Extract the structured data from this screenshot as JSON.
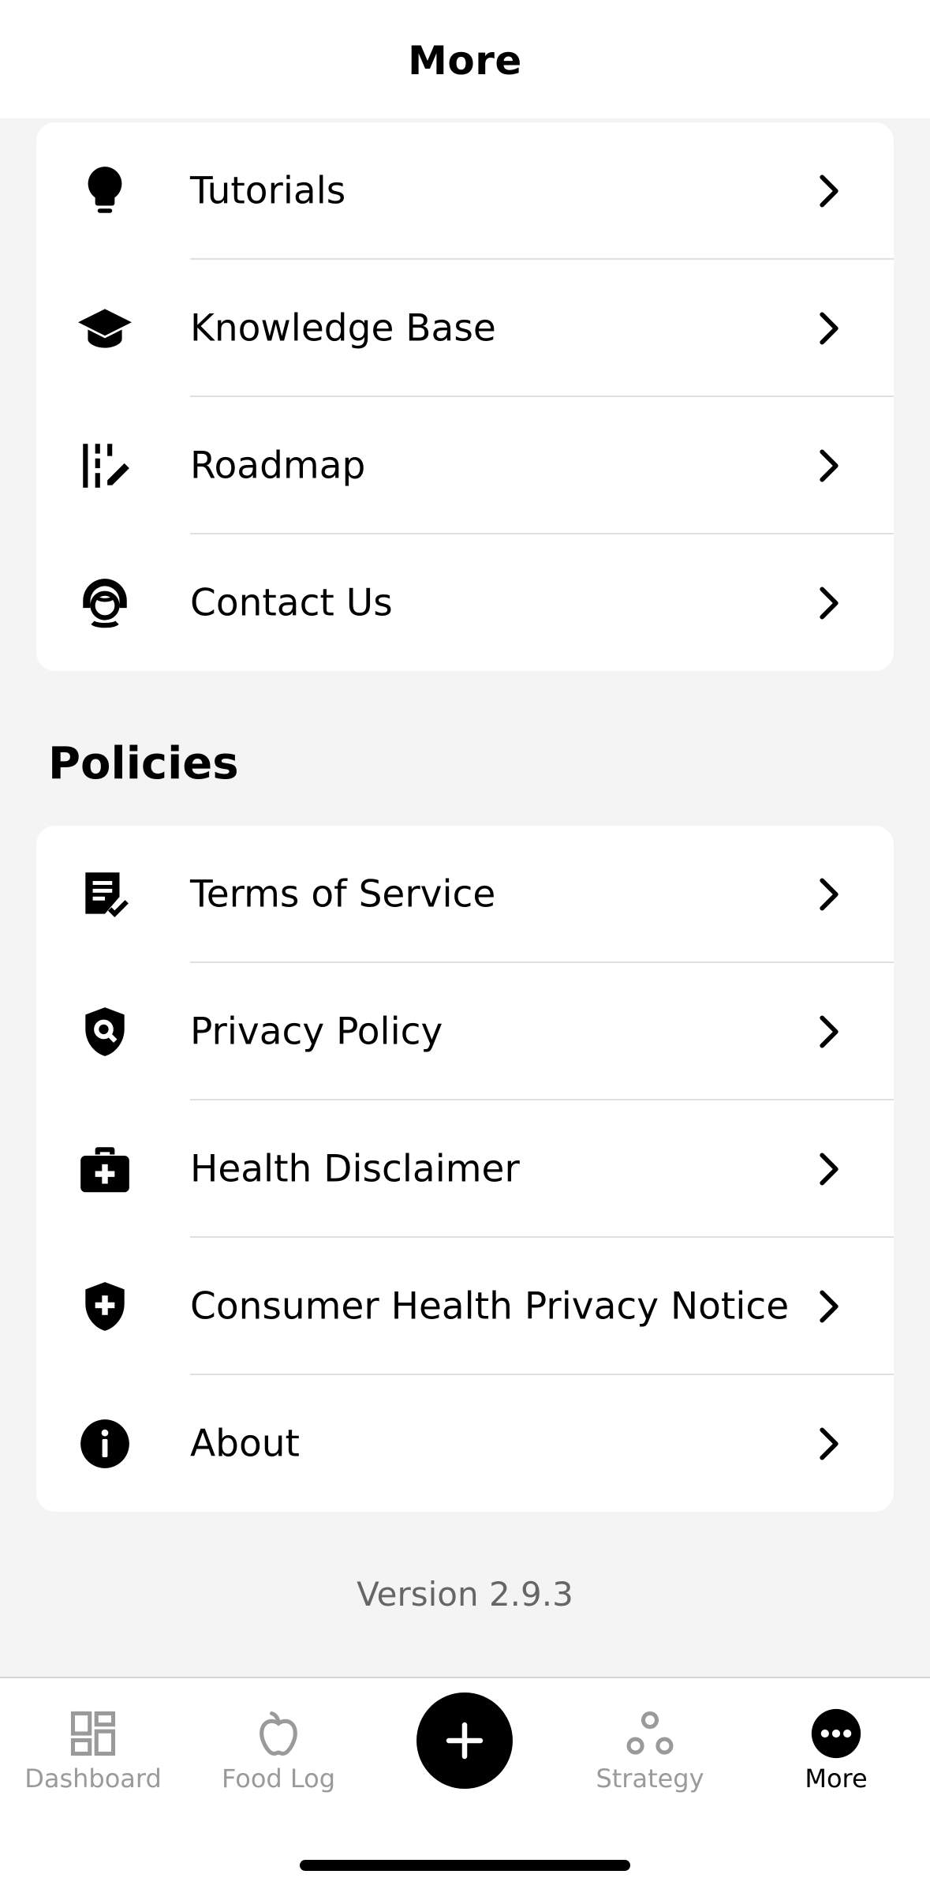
{
  "header": {
    "title": "More"
  },
  "support_items": [
    {
      "label": "Tutorials",
      "icon": "lightbulb-icon"
    },
    {
      "label": "Knowledge Base",
      "icon": "graduation-cap-icon"
    },
    {
      "label": "Roadmap",
      "icon": "roadmap-icon"
    },
    {
      "label": "Contact Us",
      "icon": "support-agent-icon"
    }
  ],
  "policies": {
    "title": "Policies",
    "items": [
      {
        "label": "Terms of Service",
        "icon": "document-check-icon"
      },
      {
        "label": "Privacy Policy",
        "icon": "shield-search-icon"
      },
      {
        "label": "Health Disclaimer",
        "icon": "medical-bag-icon"
      },
      {
        "label": "Consumer Health Privacy Notice",
        "icon": "shield-plus-icon"
      },
      {
        "label": "About",
        "icon": "info-icon"
      }
    ]
  },
  "version": "Version 2.9.3",
  "tabbar": {
    "tabs": [
      {
        "label": "Dashboard",
        "icon": "dashboard-icon",
        "active": false
      },
      {
        "label": "Food Log",
        "icon": "apple-icon",
        "active": false
      },
      {
        "label": "Strategy",
        "icon": "strategy-icon",
        "active": false
      },
      {
        "label": "More",
        "icon": "more-dots-icon",
        "active": true
      }
    ],
    "add_button_icon": "plus-icon"
  },
  "colors": {
    "background": "#f4f4f4",
    "card": "#ffffff",
    "text": "#000000",
    "inactive_tab": "#9a9a9a",
    "secondary_text": "#666666"
  }
}
